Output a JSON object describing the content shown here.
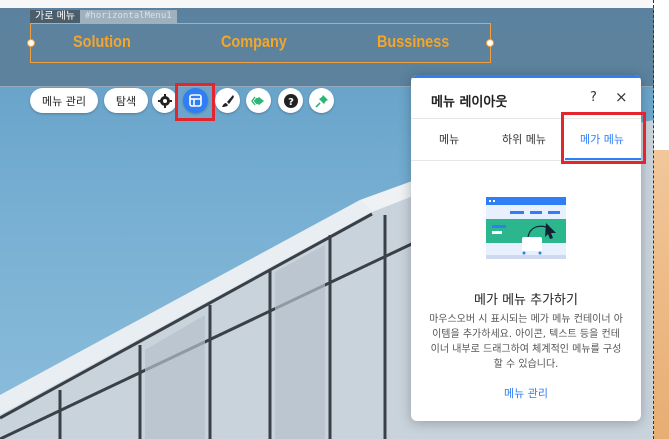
{
  "component": {
    "label": "가로 메뉴",
    "id": "#horizontalMenu1"
  },
  "menu": {
    "items": [
      "Solution",
      "Company",
      "Bussiness"
    ]
  },
  "toolbar": {
    "manage_menu": "메뉴 관리",
    "navigate": "탐색",
    "buttons": [
      "settings-icon",
      "layout-icon",
      "design-brush-icon",
      "animation-icon",
      "help-icon",
      "pin-icon"
    ]
  },
  "panel": {
    "title": "메뉴 레이아웃",
    "help": "?",
    "close": "×",
    "tabs": [
      "메뉴",
      "하위 메뉴",
      "메가 메뉴"
    ],
    "active_tab": "메가 메뉴",
    "empty_title": "메가 메뉴 추가하기",
    "empty_desc": "마우스오버 시 표시되는 메가 메뉴 컨테이너 아이템을 추가하세요. 아이콘, 텍스트 등을 컨테이너 내부로 드래그하여 체계적인 메뉴를 구성할 수 있습니다.",
    "link": "메뉴 관리"
  },
  "colors": {
    "accent": "#2f7ef5",
    "menu_text": "#f4a62a",
    "highlight": "#e3252d"
  }
}
